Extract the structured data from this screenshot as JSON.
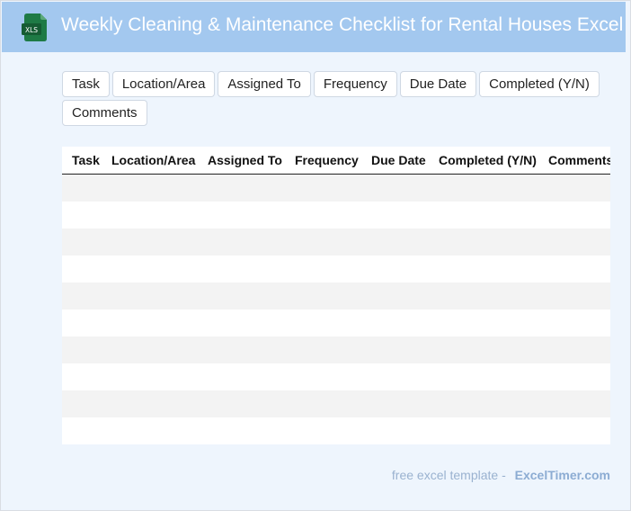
{
  "header": {
    "title": "Weekly Cleaning & Maintenance Checklist for Rental Houses Excel",
    "icon": "xls-file-icon",
    "icon_text": "XLS"
  },
  "chips": [
    {
      "label": "Task"
    },
    {
      "label": "Location/Area"
    },
    {
      "label": "Assigned To"
    },
    {
      "label": "Frequency"
    },
    {
      "label": "Due Date"
    },
    {
      "label": "Completed (Y/N)"
    },
    {
      "label": "Comments"
    }
  ],
  "table": {
    "columns": [
      "Task",
      "Location/Area",
      "Assigned To",
      "Frequency",
      "Due Date",
      "Completed (Y/N)",
      "Comments"
    ],
    "rows": [
      [
        "",
        "",
        "",
        "",
        "",
        "",
        ""
      ],
      [
        "",
        "",
        "",
        "",
        "",
        "",
        ""
      ],
      [
        "",
        "",
        "",
        "",
        "",
        "",
        ""
      ],
      [
        "",
        "",
        "",
        "",
        "",
        "",
        ""
      ],
      [
        "",
        "",
        "",
        "",
        "",
        "",
        ""
      ],
      [
        "",
        "",
        "",
        "",
        "",
        "",
        ""
      ],
      [
        "",
        "",
        "",
        "",
        "",
        "",
        ""
      ],
      [
        "",
        "",
        "",
        "",
        "",
        "",
        ""
      ],
      [
        "",
        "",
        "",
        "",
        "",
        "",
        ""
      ],
      [
        "",
        "",
        "",
        "",
        "",
        "",
        ""
      ]
    ]
  },
  "footer": {
    "text": "free excel template -",
    "brand": "ExcelTimer.com"
  },
  "colors": {
    "header_bg": "#a3c8ef",
    "page_bg": "#eef5fd",
    "icon_green": "#1e7a45",
    "row_stripe": "#f3f3f3"
  }
}
